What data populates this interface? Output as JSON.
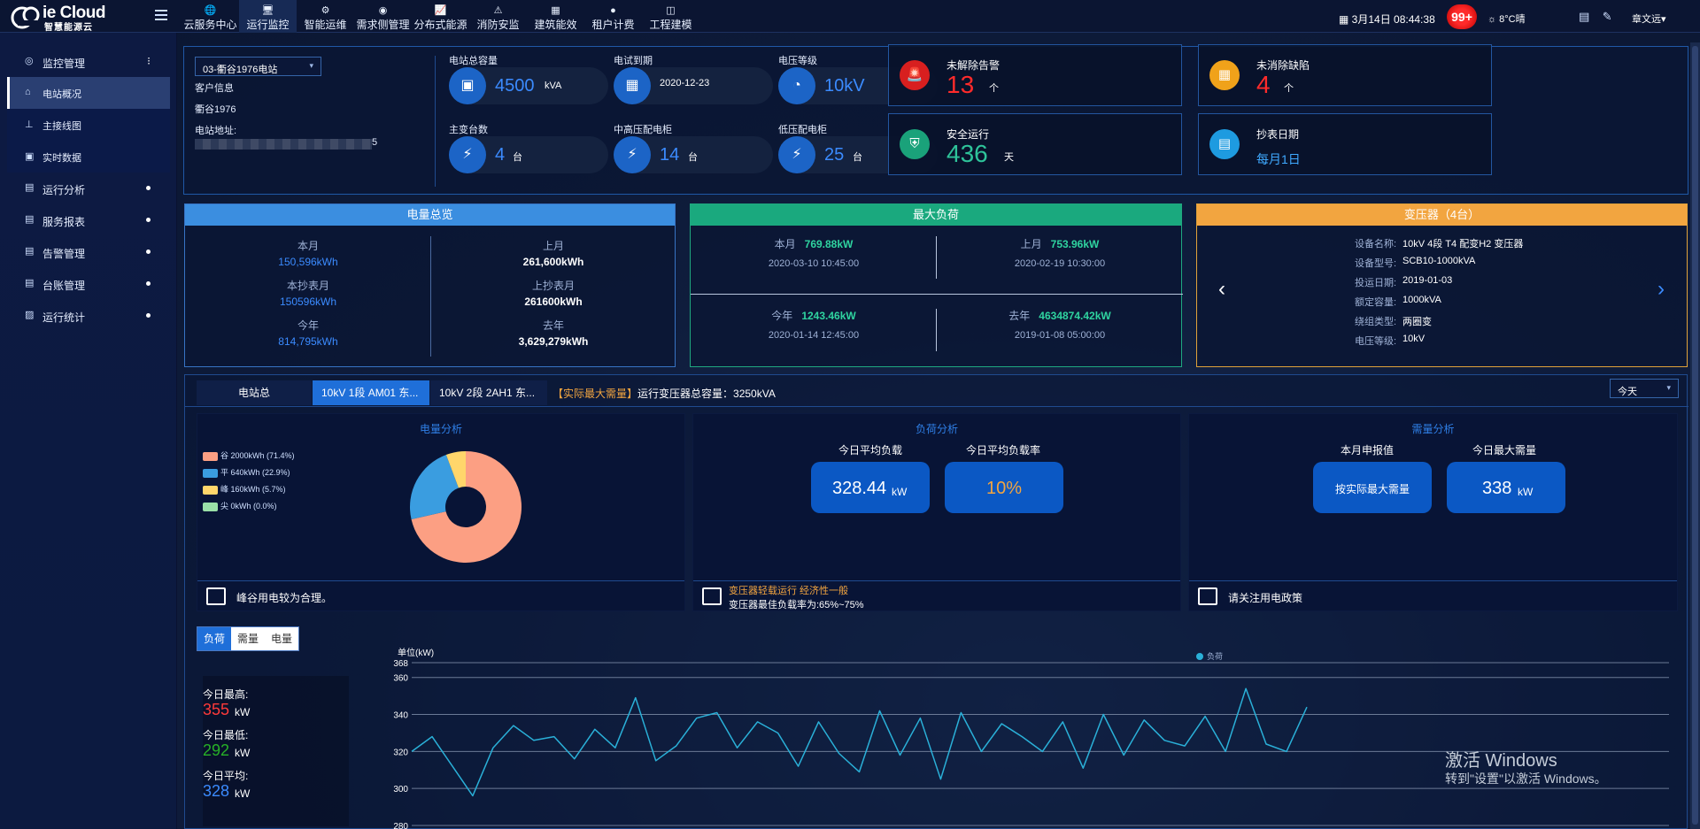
{
  "brand": {
    "name": "ie Cloud",
    "subtitle": "智慧能源云"
  },
  "nav": [
    {
      "label": "云服务中心",
      "icon": "globe-icon",
      "glyph": "🌐"
    },
    {
      "label": "运行监控",
      "icon": "monitor-icon",
      "glyph": "🖥",
      "active": true
    },
    {
      "label": "智能运维",
      "icon": "tools-icon",
      "glyph": "⚙"
    },
    {
      "label": "需求侧管理",
      "icon": "demand-icon",
      "glyph": "◉"
    },
    {
      "label": "分布式能源",
      "icon": "chart-icon",
      "glyph": "📈"
    },
    {
      "label": "消防安监",
      "icon": "alarm-icon",
      "glyph": "⚠"
    },
    {
      "label": "建筑能效",
      "icon": "building-icon",
      "glyph": "▦"
    },
    {
      "label": "租户计费",
      "icon": "coin-icon",
      "glyph": "●"
    },
    {
      "label": "工程建模",
      "icon": "model-icon",
      "glyph": "◫"
    }
  ],
  "topbar": {
    "date": "3月14日 08:44:38",
    "badge": "99+",
    "weather": "8°C晴",
    "user": "章文远"
  },
  "sidebar": {
    "groups": [
      {
        "label": "监控管理",
        "icon": "monitor-icon",
        "glyph": "◎"
      },
      {
        "label": "运行分析",
        "icon": "analysis-icon",
        "glyph": "▤"
      },
      {
        "label": "服务报表",
        "icon": "report-icon",
        "glyph": "▤"
      },
      {
        "label": "告警管理",
        "icon": "alarm-icon",
        "glyph": "▤"
      },
      {
        "label": "台账管理",
        "icon": "ledger-icon",
        "glyph": "▤"
      },
      {
        "label": "运行统计",
        "icon": "stats-icon",
        "glyph": "▨"
      }
    ],
    "subs": [
      {
        "label": "电站概况",
        "icon": "home-icon",
        "glyph": "⌂",
        "active": true
      },
      {
        "label": "主接线图",
        "icon": "wiring-icon",
        "glyph": "⊥"
      },
      {
        "label": "实时数据",
        "icon": "data-icon",
        "glyph": "▣"
      }
    ]
  },
  "station": {
    "select": "03-衢谷1976电站",
    "customer_label": "客户信息",
    "customer": "衢谷1976",
    "address_label": "电站地址:",
    "address_tail": "5"
  },
  "stats": [
    {
      "label": "电站总容量",
      "value": "4500",
      "unit": "kVA",
      "icon": "capacity-icon",
      "glyph": "▣"
    },
    {
      "label": "电试到期",
      "value": "2020-12-23",
      "unit": "",
      "icon": "calendar-icon",
      "glyph": "▦"
    },
    {
      "label": "电压等级",
      "value": "10kV",
      "unit": "",
      "icon": "gauge-icon",
      "glyph": "◔"
    },
    {
      "label": "主变台数",
      "value": "4",
      "unit": "台",
      "icon": "transformer-icon",
      "glyph": "⚡"
    },
    {
      "label": "中高压配电柜",
      "value": "14",
      "unit": "台",
      "icon": "cabinet-icon",
      "glyph": "⚡"
    },
    {
      "label": "低压配电柜",
      "value": "25",
      "unit": "台",
      "icon": "cabinet-icon",
      "glyph": "⚡"
    }
  ],
  "alarms": [
    {
      "label": "未解除告警",
      "value": "13",
      "unit": "个",
      "color": "#ff2b2b",
      "bg": "#d81f1f",
      "icon": "siren-icon",
      "glyph": "🚨"
    },
    {
      "label": "未消除缺陷",
      "value": "4",
      "unit": "个",
      "color": "#ff2b2b",
      "bg": "#f0a21a",
      "icon": "defect-icon",
      "glyph": "▦"
    },
    {
      "label": "安全运行",
      "value": "436",
      "unit": "天",
      "color": "#2ec39a",
      "bg": "#1aa27a",
      "icon": "shield-icon",
      "glyph": "⛨"
    },
    {
      "label": "抄表日期",
      "value": "每月1日",
      "unit": "",
      "color": "#3fa9ff",
      "bg": "#1e9be0",
      "icon": "meter-icon",
      "glyph": "▤"
    }
  ],
  "energy": {
    "title": "电量总览",
    "left": [
      {
        "l": "本月",
        "v": "150,596kWh"
      },
      {
        "l": "本抄表月",
        "v": "150596kWh"
      },
      {
        "l": "今年",
        "v": "814,795kWh"
      }
    ],
    "right": [
      {
        "l": "上月",
        "v": "261,600kWh"
      },
      {
        "l": "上抄表月",
        "v": "261600kWh"
      },
      {
        "l": "去年",
        "v": "3,629,279kWh"
      }
    ]
  },
  "maxload": {
    "title": "最大负荷",
    "cells": [
      {
        "l": "本月",
        "v": "769.88kW",
        "t": "2020-03-10 10:45:00"
      },
      {
        "l": "上月",
        "v": "753.96kW",
        "t": "2020-02-19 10:30:00"
      },
      {
        "l": "今年",
        "v": "1243.46kW",
        "t": "2020-01-14 12:45:00"
      },
      {
        "l": "去年",
        "v": "4634874.42kW",
        "t": "2019-01-08 05:00:00"
      }
    ]
  },
  "transformer": {
    "title": "变压器（4台）",
    "rows": [
      {
        "k": "设备名称:",
        "v": "10kV 4段 T4 配变H2 变压器"
      },
      {
        "k": "设备型号:",
        "v": "SCB10-1000kVA"
      },
      {
        "k": "投运日期:",
        "v": "2019-01-03"
      },
      {
        "k": "额定容量:",
        "v": "1000kVA"
      },
      {
        "k": "绕组类型:",
        "v": "两圈变"
      },
      {
        "k": "电压等级:",
        "v": "10kV"
      }
    ]
  },
  "tabs": [
    "电站总",
    "10kV 1段 AM01 东...",
    "10kV 2段 2AH1 东..."
  ],
  "tab_note_tag": "【实际最大需量】",
  "tab_note": "运行变压器总容量：3250kVA",
  "period_select": "今天",
  "analysis": {
    "energy_title": "电量分析",
    "legend": [
      {
        "label": "谷 2000kWh (71.4%)",
        "color": "#fc9f83"
      },
      {
        "label": "平 640kWh (22.9%)",
        "color": "#3a9de0"
      },
      {
        "label": "峰 160kWh (5.7%)",
        "color": "#ffd66b"
      },
      {
        "label": "尖 0kWh (0.0%)",
        "color": "#9ae0a8"
      }
    ],
    "energy_note": "峰谷用电较为合理。",
    "load_title": "负荷分析",
    "avg_load_label": "今日平均负载",
    "avg_load": "328.44",
    "avg_load_unit": "kW",
    "avg_rate_label": "今日平均负载率",
    "avg_rate": "10%",
    "load_note_1": "变压器轻载运行 经济性一般",
    "load_note_2": "变压器最佳负载率为:65%~75%",
    "demand_title": "需量分析",
    "declared_label": "本月申报值",
    "declared": "按实际最大需量",
    "max_demand_label": "今日最大需量",
    "max_demand": "338",
    "max_demand_unit": "kW",
    "demand_note": "请关注用电政策"
  },
  "bottom": {
    "buttons": [
      "负荷",
      "需量",
      "电量"
    ],
    "max_label": "今日最高:",
    "max": "355",
    "min_label": "今日最低:",
    "min": "292",
    "avg_label": "今日平均:",
    "avg": "328",
    "unit": "kW"
  },
  "watermark": {
    "line1": "激活 Windows",
    "line2": "转到\"设置\"以激活 Windows。"
  },
  "chart_data": {
    "type": "line",
    "ylabel": "单位(kW)",
    "ylim": [
      280,
      368
    ],
    "yticks": [
      280,
      300,
      320,
      340,
      360,
      368
    ],
    "series": [
      {
        "name": "负荷",
        "color": "#2ab0d8",
        "values": [
          320,
          328,
          312,
          296,
          322,
          334,
          326,
          328,
          316,
          332,
          322,
          349,
          315,
          323,
          338,
          341,
          322,
          336,
          330,
          312,
          336,
          319,
          309,
          342,
          318,
          338,
          305,
          341,
          320,
          335,
          328,
          320,
          336,
          311,
          340,
          318,
          337,
          326,
          323,
          339,
          320,
          354,
          324,
          320,
          344
        ]
      }
    ],
    "grid": true,
    "legend": "top-center"
  }
}
